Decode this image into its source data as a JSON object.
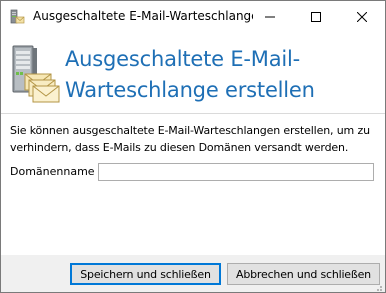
{
  "window": {
    "title": "Ausgeschaltete E-Mail-Warteschlange ...",
    "controls": {
      "minimize_icon": "minimize-icon",
      "maximize_icon": "maximize-icon",
      "close_icon": "close-icon"
    }
  },
  "header": {
    "title": "Ausgeschaltete E-Mail-Warteschlange erstellen",
    "icon": "server-mail-icon",
    "title_color": "#1e6fb5"
  },
  "body": {
    "description": "Sie können ausgeschaltete E-Mail-Warteschlangen erstellen, um zu verhindern, dass E-Mails zu diesen Domänen versandt werden.",
    "domain_field": {
      "label": "Domänenname",
      "value": "",
      "placeholder": ""
    }
  },
  "footer": {
    "save_label": "Speichern und schließen",
    "cancel_label": "Abbrechen und schließen"
  },
  "colors": {
    "accent": "#0078d7",
    "footer_bg": "#f0f0f0"
  }
}
